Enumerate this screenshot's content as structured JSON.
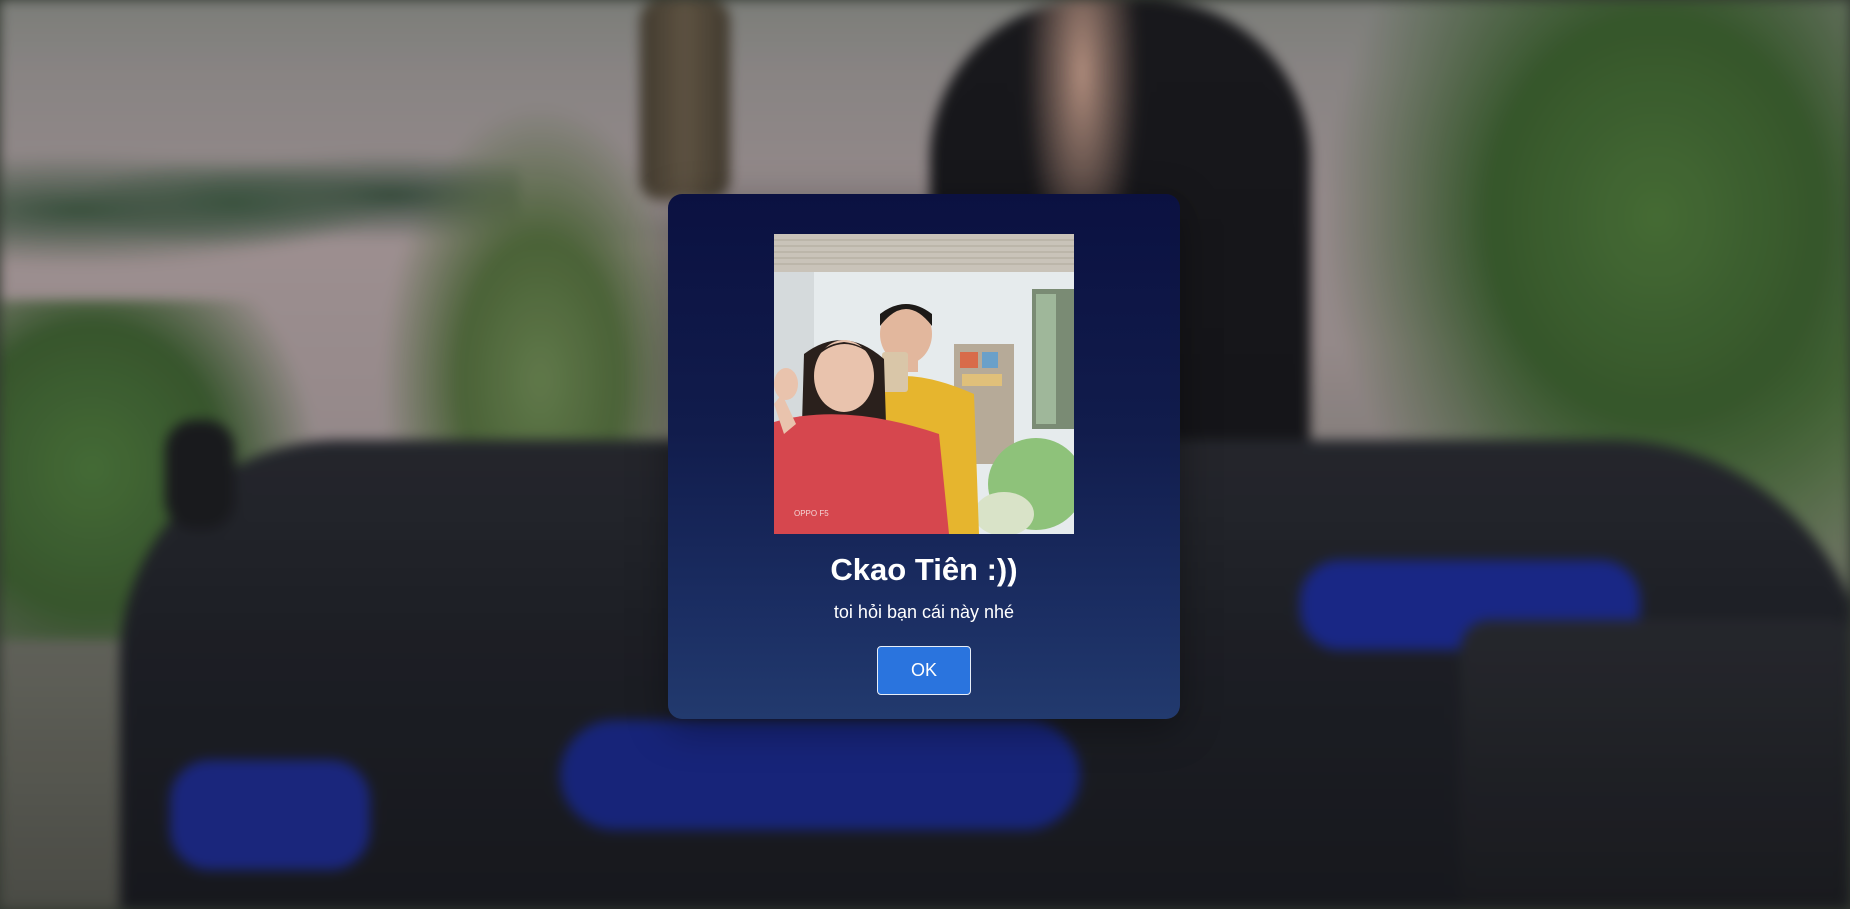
{
  "background": {
    "description_icon": "blurred-photo-background"
  },
  "modal": {
    "image_icon": "photo-two-people-selfie",
    "title": "Ckao Tiên :))",
    "subtitle": "toi hỏi bạn cái này nhé",
    "ok_label": "OK",
    "colors": {
      "gradient_top": "#0b1141",
      "gradient_bottom": "#223a6e",
      "button": "#2a74de"
    }
  }
}
